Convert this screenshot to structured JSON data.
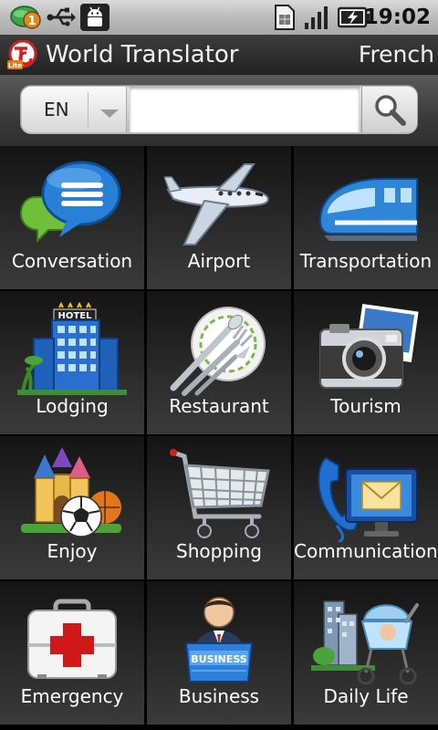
{
  "status_bar": {
    "notification_count": "1",
    "time": "19:02",
    "icons": [
      "notification-bubble-icon",
      "usb-icon",
      "android-debug-icon",
      "sim-card-icon",
      "signal-icon",
      "battery-charging-icon"
    ]
  },
  "title_bar": {
    "app_title": "World Translator",
    "target_language": "French",
    "logo_text": "Lite"
  },
  "search": {
    "source_language": "EN",
    "query": "",
    "placeholder": ""
  },
  "categories": [
    {
      "label": "Conversation",
      "icon": "speech-bubbles-icon"
    },
    {
      "label": "Airport",
      "icon": "airplane-icon"
    },
    {
      "label": "Transportation",
      "icon": "train-icon"
    },
    {
      "label": "Lodging",
      "icon": "hotel-icon"
    },
    {
      "label": "Restaurant",
      "icon": "cutlery-plate-icon"
    },
    {
      "label": "Tourism",
      "icon": "camera-icon"
    },
    {
      "label": "Enjoy",
      "icon": "castle-ball-icon"
    },
    {
      "label": "Shopping",
      "icon": "shopping-cart-icon"
    },
    {
      "label": "Communications",
      "icon": "phone-mail-icon"
    },
    {
      "label": "Emergency",
      "icon": "first-aid-kit-icon"
    },
    {
      "label": "Business",
      "icon": "businessman-icon"
    },
    {
      "label": "Daily Life",
      "icon": "stroller-city-icon"
    }
  ],
  "colors": {
    "accent_blue": "#2a7fd6",
    "emergency_red": "#d01818",
    "tile_text": "#ffffff"
  },
  "tile_decor": {
    "hotel_sign": "HOTEL",
    "business_sign": "BUSINESS"
  }
}
